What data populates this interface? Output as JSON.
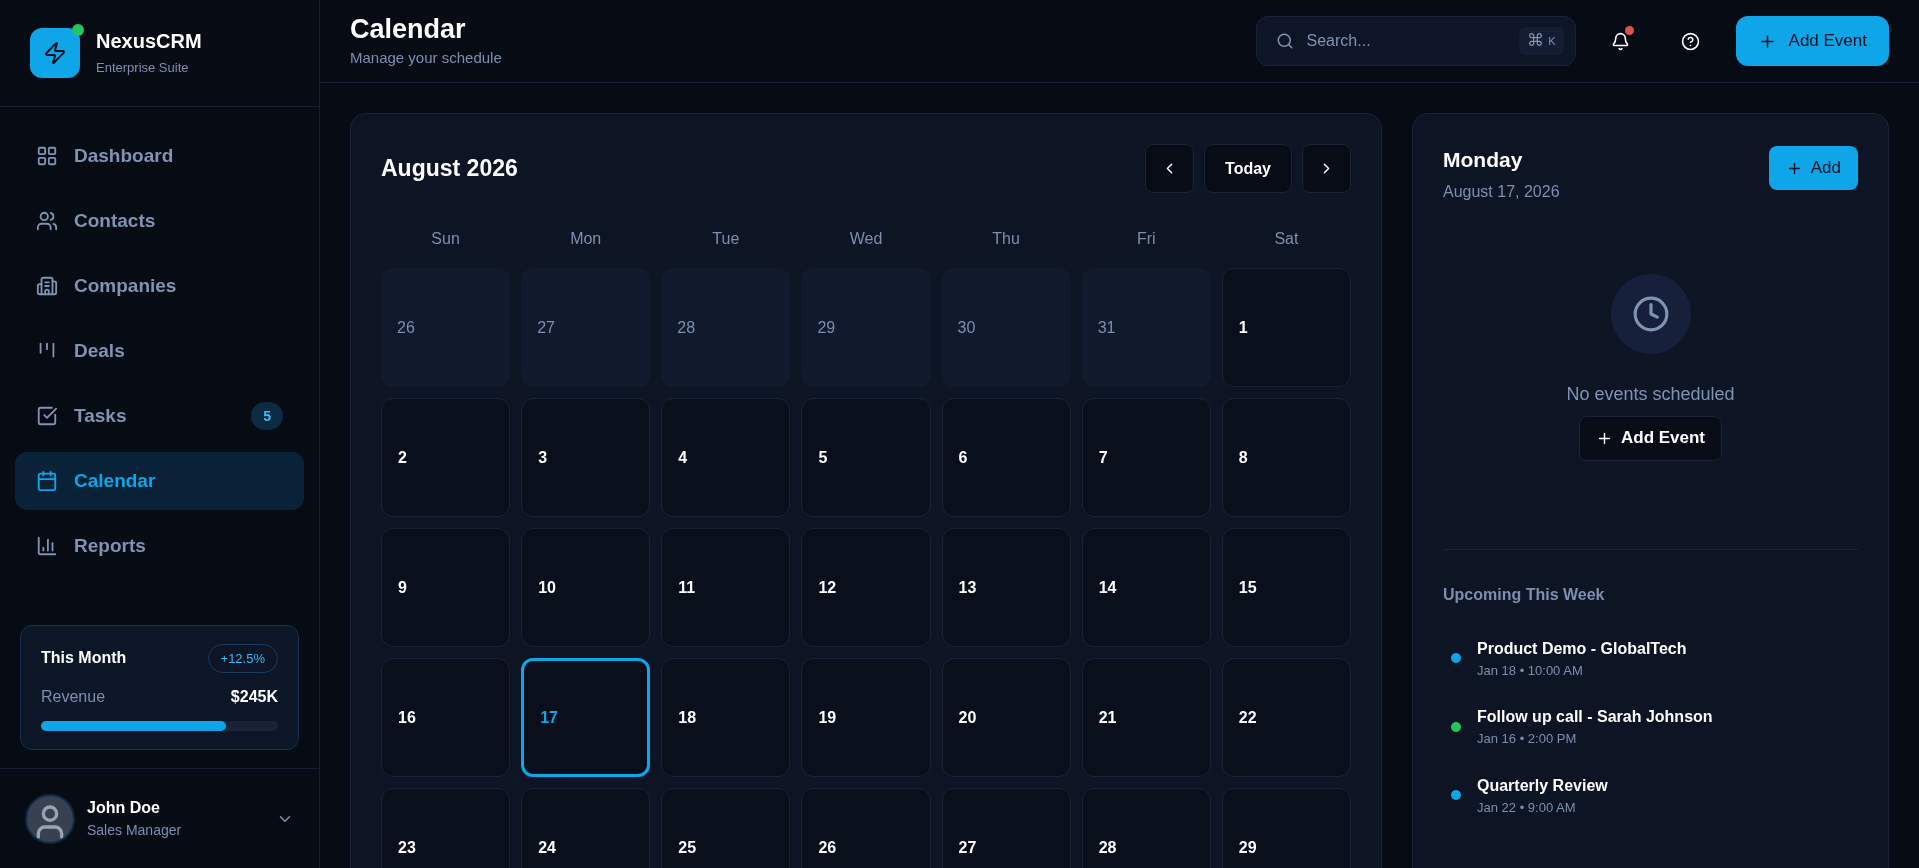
{
  "brand": {
    "name": "NexusCRM",
    "subtitle": "Enterprise Suite",
    "online": true
  },
  "nav": [
    {
      "label": "Dashboard",
      "selected": false
    },
    {
      "label": "Contacts",
      "selected": false
    },
    {
      "label": "Companies",
      "selected": false
    },
    {
      "label": "Deals",
      "selected": false
    },
    {
      "label": "Tasks",
      "selected": false,
      "badge": "5"
    },
    {
      "label": "Calendar",
      "selected": true
    },
    {
      "label": "Reports",
      "selected": false
    }
  ],
  "summary": {
    "title": "This Month",
    "change": "+12.5%",
    "label": "Revenue",
    "value": "$245K",
    "level": 0.78
  },
  "user": {
    "name": "John Doe",
    "role": "Sales Manager"
  },
  "header": {
    "title": "Calendar",
    "subtitle": "Manage your schedule",
    "search_placeholder": "Search...",
    "shortcut": [
      "⌘",
      "K"
    ],
    "notifications": true,
    "add_button": "Add Event"
  },
  "calendar": {
    "month": "August 2026",
    "today_button": "Today",
    "weekdays": [
      "Sun",
      "Mon",
      "Tue",
      "Wed",
      "Thu",
      "Fri",
      "Sat"
    ],
    "days": [
      {
        "label": "26",
        "muted": true,
        "selected": false
      },
      {
        "label": "27",
        "muted": true,
        "selected": false
      },
      {
        "label": "28",
        "muted": true,
        "selected": false
      },
      {
        "label": "29",
        "muted": true,
        "selected": false
      },
      {
        "label": "30",
        "muted": true,
        "selected": false
      },
      {
        "label": "31",
        "muted": true,
        "selected": false
      },
      {
        "label": "1",
        "muted": false,
        "selected": false
      },
      {
        "label": "2",
        "muted": false,
        "selected": false
      },
      {
        "label": "3",
        "muted": false,
        "selected": false
      },
      {
        "label": "4",
        "muted": false,
        "selected": false
      },
      {
        "label": "5",
        "muted": false,
        "selected": false
      },
      {
        "label": "6",
        "muted": false,
        "selected": false
      },
      {
        "label": "7",
        "muted": false,
        "selected": false
      },
      {
        "label": "8",
        "muted": false,
        "selected": false
      },
      {
        "label": "9",
        "muted": false,
        "selected": false
      },
      {
        "label": "10",
        "muted": false,
        "selected": false
      },
      {
        "label": "11",
        "muted": false,
        "selected": false
      },
      {
        "label": "12",
        "muted": false,
        "selected": false
      },
      {
        "label": "13",
        "muted": false,
        "selected": false
      },
      {
        "label": "14",
        "muted": false,
        "selected": false
      },
      {
        "label": "15",
        "muted": false,
        "selected": false
      },
      {
        "label": "16",
        "muted": false,
        "selected": false
      },
      {
        "label": "17",
        "muted": false,
        "selected": true
      },
      {
        "label": "18",
        "muted": false,
        "selected": false
      },
      {
        "label": "19",
        "muted": false,
        "selected": false
      },
      {
        "label": "20",
        "muted": false,
        "selected": false
      },
      {
        "label": "21",
        "muted": false,
        "selected": false
      },
      {
        "label": "22",
        "muted": false,
        "selected": false
      },
      {
        "label": "23",
        "muted": false,
        "selected": false
      },
      {
        "label": "24",
        "muted": false,
        "selected": false
      },
      {
        "label": "25",
        "muted": false,
        "selected": false
      },
      {
        "label": "26",
        "muted": false,
        "selected": false
      },
      {
        "label": "27",
        "muted": false,
        "selected": false
      },
      {
        "label": "28",
        "muted": false,
        "selected": false
      },
      {
        "label": "29",
        "muted": false,
        "selected": false
      }
    ]
  },
  "day_panel": {
    "weekday": "Monday",
    "date": "August 17, 2026",
    "add_button": "Add",
    "empty_text": "No events scheduled",
    "empty_button": "Add Event",
    "upcoming_title": "Upcoming This Week",
    "upcoming": [
      {
        "title": "Product Demo - GlobalTech",
        "time": "Jan 18 • 10:00 AM",
        "color": "#0ea5e9"
      },
      {
        "title": "Follow up call - Sarah Johnson",
        "time": "Jan 16 • 2:00 PM",
        "color": "#22c55e"
      },
      {
        "title": "Quarterly Review",
        "time": "Jan 22 • 9:00 AM",
        "color": "#0ea5e9"
      }
    ]
  }
}
